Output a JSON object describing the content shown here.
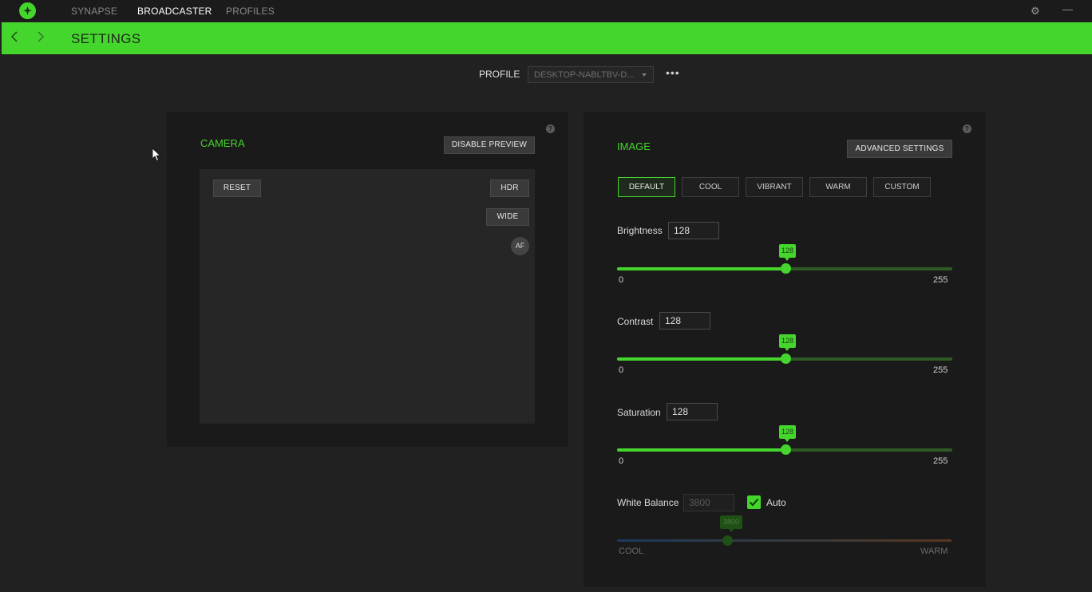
{
  "topbar": {
    "tabs": [
      {
        "label": "SYNAPSE"
      },
      {
        "label": "BROADCASTER"
      },
      {
        "label": "PROFILES"
      }
    ]
  },
  "header": {
    "title": "SETTINGS"
  },
  "profile": {
    "label": "PROFILE",
    "selected": "DESKTOP-NABLTBV-D..."
  },
  "camera": {
    "title": "CAMERA",
    "disable_preview": "DISABLE PREVIEW",
    "reset": "RESET",
    "hdr": "HDR",
    "wide": "WIDE",
    "af": "AF"
  },
  "image": {
    "title": "IMAGE",
    "advanced": "ADVANCED SETTINGS",
    "presets": [
      "DEFAULT",
      "COOL",
      "VIBRANT",
      "WARM",
      "CUSTOM"
    ],
    "active_preset": "DEFAULT",
    "sliders": [
      {
        "label": "Brightness",
        "value": "128",
        "min": "0",
        "max": "255"
      },
      {
        "label": "Contrast",
        "value": "128",
        "min": "0",
        "max": "255"
      },
      {
        "label": "Saturation",
        "value": "128",
        "min": "0",
        "max": "255"
      }
    ],
    "white_balance": {
      "label": "White Balance",
      "value": "3800",
      "auto_label": "Auto",
      "auto_checked": true,
      "min_label": "COOL",
      "max_label": "WARM",
      "level_fraction": 0.33
    }
  },
  "colors": {
    "accent": "#44d62c",
    "panel": "#1a1a1a",
    "background": "#212121"
  }
}
